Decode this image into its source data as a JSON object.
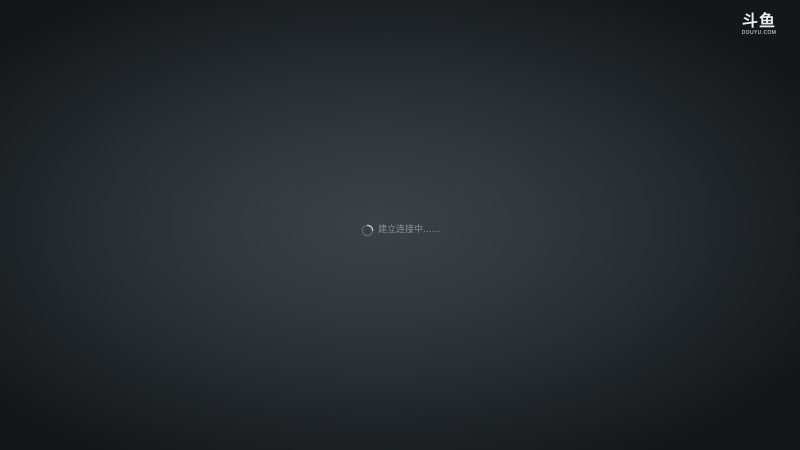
{
  "player": {
    "logo": {
      "mark": "斗鱼",
      "sub": "DOUYU.COM"
    },
    "loading": {
      "icon": "spinner-icon",
      "text": "建立连接中......"
    }
  }
}
